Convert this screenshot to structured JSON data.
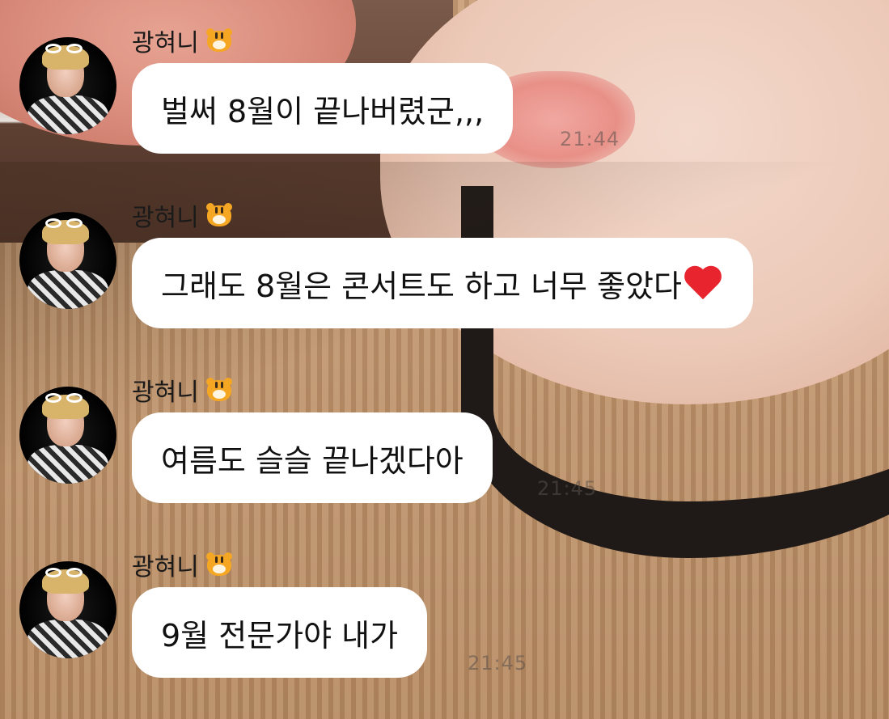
{
  "messages": [
    {
      "sender": "광혀니",
      "sender_icon": "tiger-face-icon",
      "text": "벌써 8월이 끝나버렸군,,,",
      "time": "21:44",
      "heart": false
    },
    {
      "sender": "광혀니",
      "sender_icon": "tiger-face-icon",
      "text": "그래도 8월은 콘서트도 하고 너무 좋았다",
      "time": "",
      "heart": true,
      "heart_icon": "red-heart-icon"
    },
    {
      "sender": "광혀니",
      "sender_icon": "tiger-face-icon",
      "text": "여름도 슬슬 끝나겠다아",
      "time": "21:45",
      "heart": false
    },
    {
      "sender": "광혀니",
      "sender_icon": "tiger-face-icon",
      "text": "9월 전문가야 내가",
      "time": "21:45",
      "heart": false
    }
  ],
  "colors": {
    "bubble": "#ffffff",
    "text": "#111111",
    "heart": "#e8242f",
    "tiger": "#f5a623"
  }
}
